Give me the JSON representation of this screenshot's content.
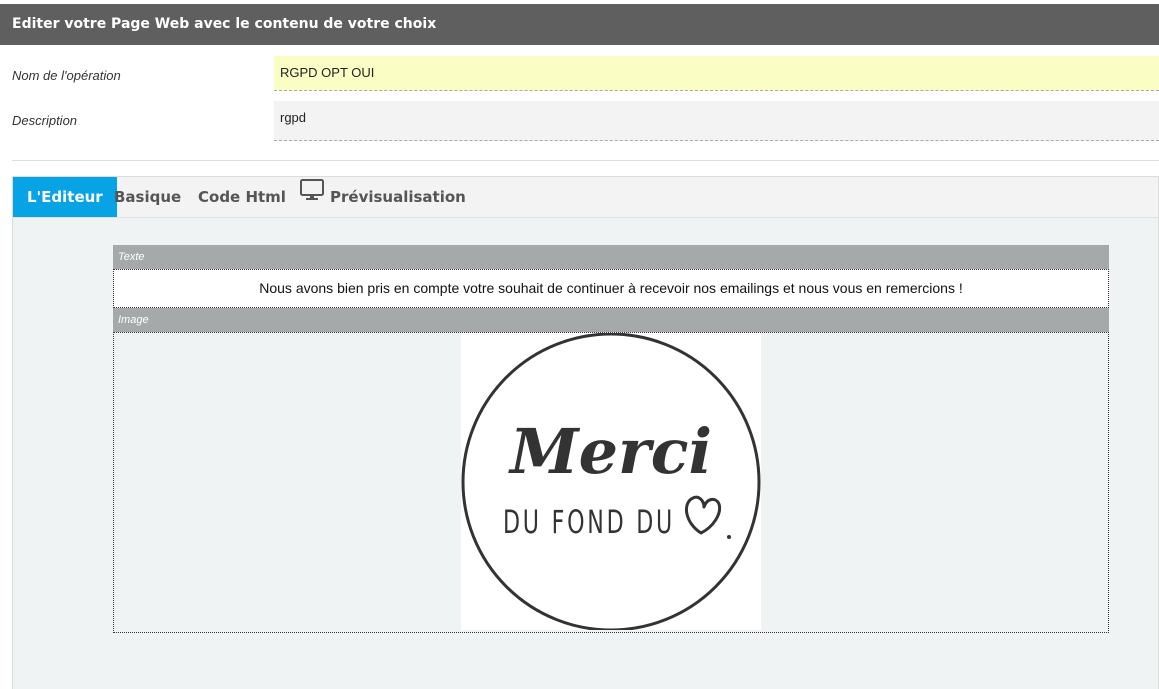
{
  "header": {
    "title": "Editer votre Page Web avec le contenu de votre choix"
  },
  "form": {
    "name_label": "Nom de l'opération",
    "name_value": "RGPD OPT OUI",
    "desc_label": "Description",
    "desc_value": "rgpd"
  },
  "tabs": [
    {
      "label": "L'Editeur",
      "active": true
    },
    {
      "label": "Basique"
    },
    {
      "label": "Code Html"
    },
    {
      "label": "Prévisualisation",
      "icon": "monitor-icon"
    }
  ],
  "blocks": {
    "text": {
      "header": "Texte",
      "content": "Nous avons bien pris en compte votre souhait de continuer à recevoir nos emailings et nous vous en remercions !"
    },
    "image": {
      "header": "Image",
      "line1": "Merci",
      "line2": "DU FOND DU"
    }
  },
  "colors": {
    "header_bg": "#5f5f5f",
    "active_tab": "#07a3e4",
    "highlight_field": "#fafdc4",
    "block_header": "#a6a9aa"
  }
}
